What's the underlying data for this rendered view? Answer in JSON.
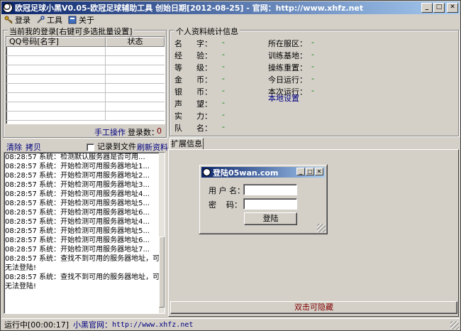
{
  "window": {
    "title": "欧冠足球小黑V0.05-欧冠足球辅助工具  创始日期[2012-08-25] - 官网：http://www.xhfz.net",
    "min": "_",
    "max": "□",
    "close": "✕"
  },
  "menu": {
    "login": "登录",
    "tools": "工具",
    "about": "关于"
  },
  "login_list": {
    "title": "当前我的登录[右键可多选批量设置]",
    "columns": [
      "QQ号码[名字]",
      "状态"
    ],
    "manual_label": "手工操作",
    "count_label": "登录数：",
    "count_value": "0"
  },
  "profile": {
    "title": "个人资料统计信息",
    "left": [
      {
        "k": "名",
        "k2": "字",
        "v": "-"
      },
      {
        "k": "经",
        "k2": "验",
        "v": "-"
      },
      {
        "k": "等",
        "k2": "级",
        "v": "-"
      },
      {
        "k": "金",
        "k2": "币",
        "v": "-"
      },
      {
        "k": "银",
        "k2": "币",
        "v": "-"
      },
      {
        "k": "声",
        "k2": "望",
        "v": "-"
      },
      {
        "k": "实",
        "k2": "力",
        "v": "-"
      },
      {
        "k": "队",
        "k2": "名",
        "v": "-"
      }
    ],
    "right": [
      {
        "k": "所在服区：",
        "v": "-"
      },
      {
        "k": "训练基地：",
        "v": "-"
      },
      {
        "k": "操练重置：",
        "v": "-"
      },
      {
        "k": "今日运行：",
        "v": "-"
      },
      {
        "k": "本次运行：",
        "v": "-"
      }
    ],
    "local_settings": "本地设置"
  },
  "log": {
    "clear": "清除",
    "copy": "拷贝",
    "record_to_file": "记录到文件",
    "refresh": "刷新资料",
    "lines": [
      "08:28:57 系统：检测默认服务器是否可用...",
      "08:28:57 系统：开始检测可用服务器地址1...",
      "08:28:57 系统：开始检测可用服务器地址2...",
      "08:28:57 系统：开始检测可用服务器地址3...",
      "08:28:57 系统：开始检测可用服务器地址4...",
      "08:28:57 系统：开始检测可用服务器地址5...",
      "08:28:57 系统：开始检测可用服务器地址6...",
      "08:28:57 系统：开始检测可用服务器地址4...",
      "08:28:57 系统：开始检测可用服务器地址5...",
      "08:28:57 系统：开始检测可用服务器地址6...",
      "08:28:57 系统：开始检测可用服务器地址7...",
      "08:28:57 系统：查找不到可用的服务器地址，可能",
      "无法登陆!",
      "08:28:57 系统：查找不到可用的服务器地址，可能",
      "无法登陆!"
    ]
  },
  "ext_tab": "扩展信息",
  "login_dialog": {
    "title": "登陆05wan.com",
    "username_label": "用 户 名：",
    "password_label": "密    码：",
    "username_value": "",
    "password_value": "",
    "submit": "登陆"
  },
  "hide_button": "双击可隐藏",
  "status": {
    "running": "运行中[00:00:17]",
    "site_label": "小黑官网：",
    "site_url": "http://www.xhfz.net"
  }
}
